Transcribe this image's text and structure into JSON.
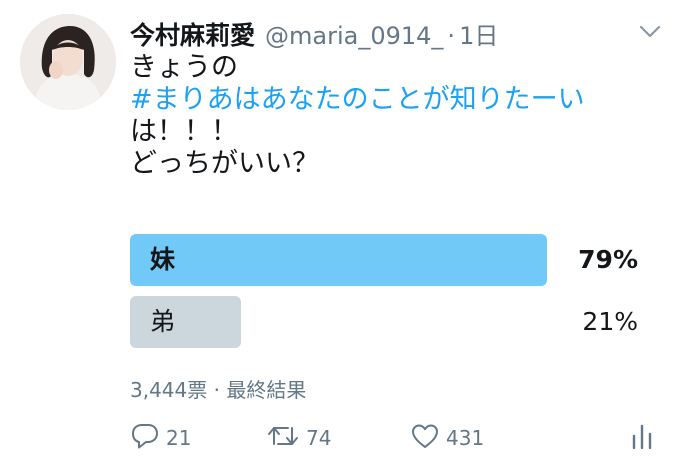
{
  "tweet": {
    "author_name": "今村麻莉愛",
    "handle": "@maria_0914_",
    "separator": "·",
    "time": "1日",
    "text_lines": [
      "きょうの",
      "#まりあはあなたのことが知りたーい",
      "は！！！",
      "どっちがいい？"
    ]
  },
  "poll": {
    "options": [
      {
        "label": "妹",
        "percent_text": "79%",
        "percent": 79,
        "winner": true
      },
      {
        "label": "弟",
        "percent_text": "21%",
        "percent": 21,
        "winner": false
      }
    ],
    "meta": "3,444票 · 最終結果"
  },
  "actions": {
    "reply_count": "21",
    "retweet_count": "74",
    "like_count": "431"
  },
  "colors": {
    "accent": "#1da1f2",
    "winner_bar": "#71c9f8",
    "loser_bar": "#ccd6dd",
    "muted_text": "#657786"
  },
  "icons": {
    "caret": "chevron-down-icon",
    "reply": "reply-icon",
    "retweet": "retweet-icon",
    "like": "heart-icon",
    "analytics": "analytics-icon"
  }
}
